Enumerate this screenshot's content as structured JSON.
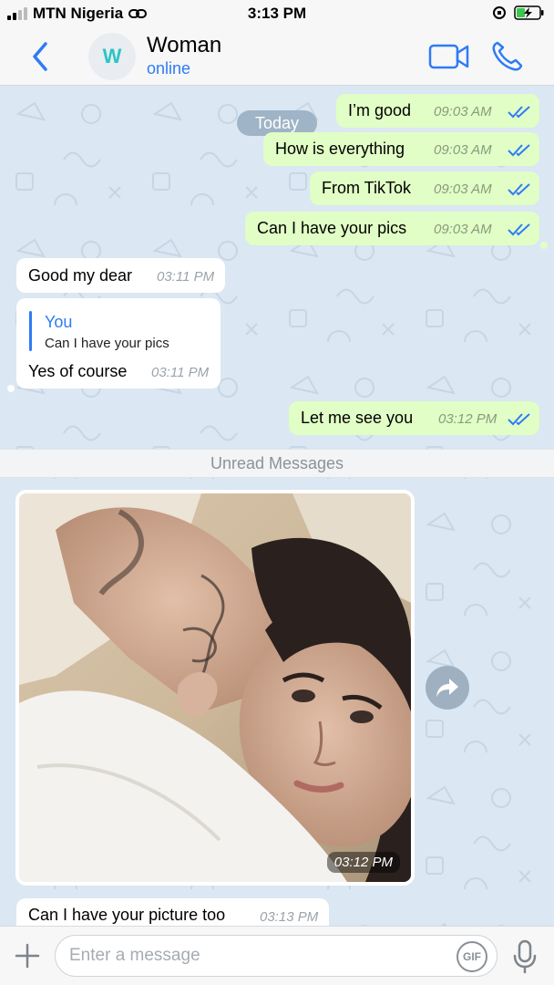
{
  "status_bar": {
    "carrier": "MTN Nigeria",
    "time": "3:13 PM"
  },
  "header": {
    "avatar_letter": "W",
    "contact_name": "Woman",
    "contact_status": "online",
    "icons": [
      "chevron-left-icon",
      "video-call-icon",
      "phone-icon"
    ]
  },
  "chat": {
    "date_pill": "Today",
    "messages": [
      {
        "dir": "out",
        "text": "I’m good",
        "time": "09:03 AM",
        "status": "read"
      },
      {
        "dir": "out",
        "text": "How is everything",
        "time": "09:03 AM",
        "status": "read"
      },
      {
        "dir": "out",
        "text": "From TikTok",
        "time": "09:03 AM",
        "status": "read"
      },
      {
        "dir": "out",
        "text": "Can I have your pics",
        "time": "09:03 AM",
        "status": "read"
      },
      {
        "dir": "in",
        "text": "Good my dear",
        "time": "03:11 PM"
      },
      {
        "dir": "in",
        "reply_to_name": "You",
        "reply_to_text": "Can I have your pics",
        "text": "Yes of course",
        "time": "03:11 PM"
      },
      {
        "dir": "out",
        "text": "Let me see you",
        "time": "03:12 PM",
        "status": "read"
      },
      {
        "dir": "in",
        "type": "photo",
        "time": "03:12 PM"
      },
      {
        "dir": "in",
        "text": "Can I have your picture too",
        "time": "03:13 PM"
      }
    ],
    "unread_label": "Unread Messages"
  },
  "input": {
    "placeholder": "Enter a message",
    "gif_label": "GIF"
  },
  "colors": {
    "accent": "#2f7bf6",
    "outgoing_bubble": "#e1fec6",
    "incoming_bubble": "#ffffff",
    "chat_background": "#dbe7f2",
    "read_ticks": "#2f7bf6"
  }
}
